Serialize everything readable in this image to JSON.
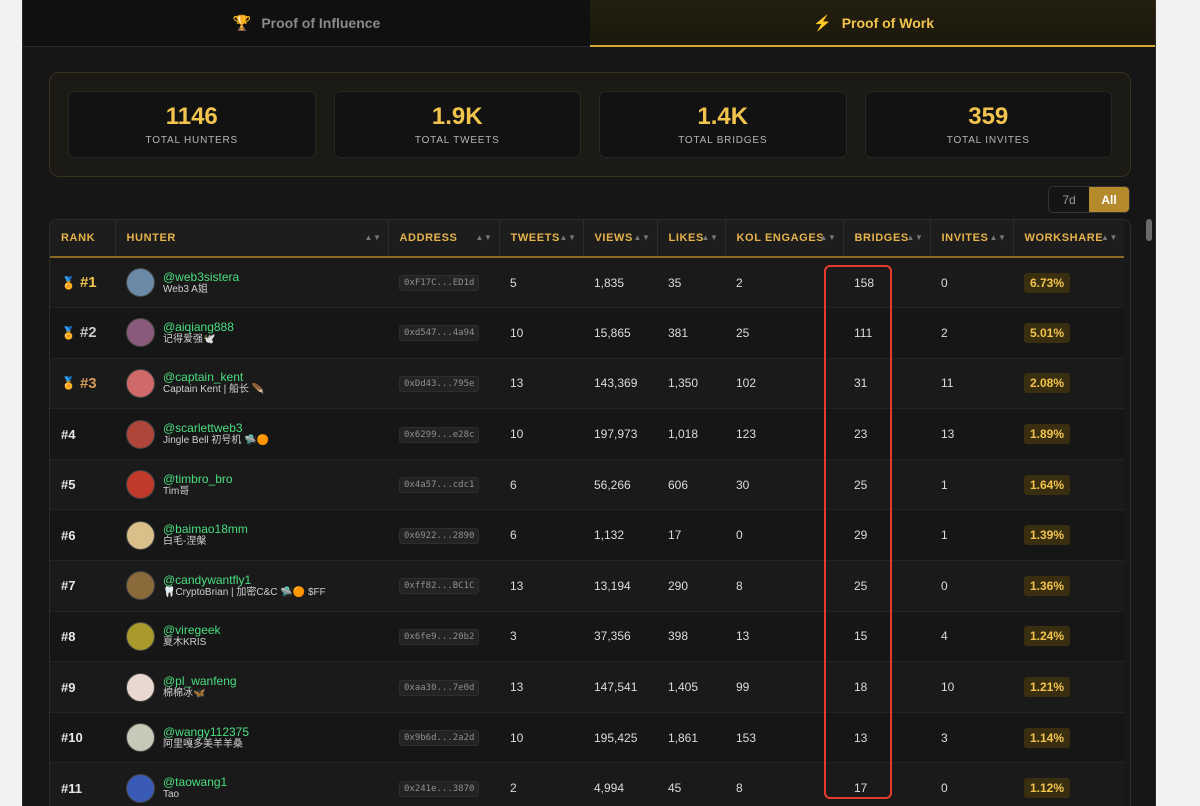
{
  "tabs": [
    {
      "label": "Proof of Influence",
      "icon": "trophy-icon",
      "active": false
    },
    {
      "label": "Proof of Work",
      "icon": "lightning-icon",
      "active": true
    }
  ],
  "stats": [
    {
      "value": "1146",
      "label": "TOTAL HUNTERS"
    },
    {
      "value": "1.9K",
      "label": "TOTAL TWEETS"
    },
    {
      "value": "1.4K",
      "label": "TOTAL BRIDGES"
    },
    {
      "value": "359",
      "label": "TOTAL INVITES"
    }
  ],
  "range": {
    "options": [
      "7d",
      "All"
    ],
    "selected": "All"
  },
  "table": {
    "columns": [
      "RANK",
      "HUNTER",
      "ADDRESS",
      "TWEETS",
      "VIEWS",
      "LIKES",
      "KOL ENGAGES",
      "BRIDGES",
      "INVITES",
      "WORKSHARE"
    ],
    "rows": [
      {
        "rank": "#1",
        "medal": "gold",
        "handle": "@web3sistera",
        "sub": "Web3 A姐",
        "address": "0xF17C...ED1d",
        "tweets": "5",
        "views": "1,835",
        "likes": "35",
        "kol": "2",
        "bridges": "158",
        "invites": "0",
        "workshare": "6.73%",
        "avatar": "#6a8aa8"
      },
      {
        "rank": "#2",
        "medal": "silver",
        "handle": "@aiqiang888",
        "sub": "记得爱强🕊️",
        "address": "0xd547...4a94",
        "tweets": "10",
        "views": "15,865",
        "likes": "381",
        "kol": "25",
        "bridges": "111",
        "invites": "2",
        "workshare": "5.01%",
        "avatar": "#8a5a7a"
      },
      {
        "rank": "#3",
        "medal": "bronze",
        "handle": "@captain_kent",
        "sub": "Captain Kent | 船长 🪶",
        "address": "0xDd43...795e",
        "tweets": "13",
        "views": "143,369",
        "likes": "1,350",
        "kol": "102",
        "bridges": "31",
        "invites": "11",
        "workshare": "2.08%",
        "avatar": "#d06a6a"
      },
      {
        "rank": "#4",
        "medal": "",
        "handle": "@scarlettweb3",
        "sub": "Jingle Bell 初号机 🛸🟠",
        "address": "0x6299...e28c",
        "tweets": "10",
        "views": "197,973",
        "likes": "1,018",
        "kol": "123",
        "bridges": "23",
        "invites": "13",
        "workshare": "1.89%",
        "avatar": "#b0453a"
      },
      {
        "rank": "#5",
        "medal": "",
        "handle": "@timbro_bro",
        "sub": "Tim哥",
        "address": "0x4a57...cdc1",
        "tweets": "6",
        "views": "56,266",
        "likes": "606",
        "kol": "30",
        "bridges": "25",
        "invites": "1",
        "workshare": "1.64%",
        "avatar": "#c0392b"
      },
      {
        "rank": "#6",
        "medal": "",
        "handle": "@baimao18mm",
        "sub": "白毛-涅槃",
        "address": "0x6922...2890",
        "tweets": "6",
        "views": "1,132",
        "likes": "17",
        "kol": "0",
        "bridges": "29",
        "invites": "1",
        "workshare": "1.39%",
        "avatar": "#d9c08a"
      },
      {
        "rank": "#7",
        "medal": "",
        "handle": "@candywantfly1",
        "sub": "🦷CryptoBrian | 加密C&C 🛸🟠 $FF",
        "address": "0xff82...BC1C",
        "tweets": "13",
        "views": "13,194",
        "likes": "290",
        "kol": "8",
        "bridges": "25",
        "invites": "0",
        "workshare": "1.36%",
        "avatar": "#8a6a3a"
      },
      {
        "rank": "#8",
        "medal": "",
        "handle": "@viregeek",
        "sub": "夏木KRIS",
        "address": "0x6fe9...20b2",
        "tweets": "3",
        "views": "37,356",
        "likes": "398",
        "kol": "13",
        "bridges": "15",
        "invites": "4",
        "workshare": "1.24%",
        "avatar": "#a89a2a"
      },
      {
        "rank": "#9",
        "medal": "",
        "handle": "@pl_wanfeng",
        "sub": "棉棉冰🦋",
        "address": "0xaa30...7e0d",
        "tweets": "13",
        "views": "147,541",
        "likes": "1,405",
        "kol": "99",
        "bridges": "18",
        "invites": "10",
        "workshare": "1.21%",
        "avatar": "#e8d8d0"
      },
      {
        "rank": "#10",
        "medal": "",
        "handle": "@wangy112375",
        "sub": "阿里嘎多美羊羊桑",
        "address": "0x9b6d...2a2d",
        "tweets": "10",
        "views": "195,425",
        "likes": "1,861",
        "kol": "153",
        "bridges": "13",
        "invites": "3",
        "workshare": "1.14%",
        "avatar": "#c8c8b8"
      },
      {
        "rank": "#11",
        "medal": "",
        "handle": "@taowang1",
        "sub": "Tao",
        "address": "0x241e...3870",
        "tweets": "2",
        "views": "4,994",
        "likes": "45",
        "kol": "8",
        "bridges": "17",
        "invites": "0",
        "workshare": "1.12%",
        "avatar": "#3a5ab8"
      }
    ]
  }
}
